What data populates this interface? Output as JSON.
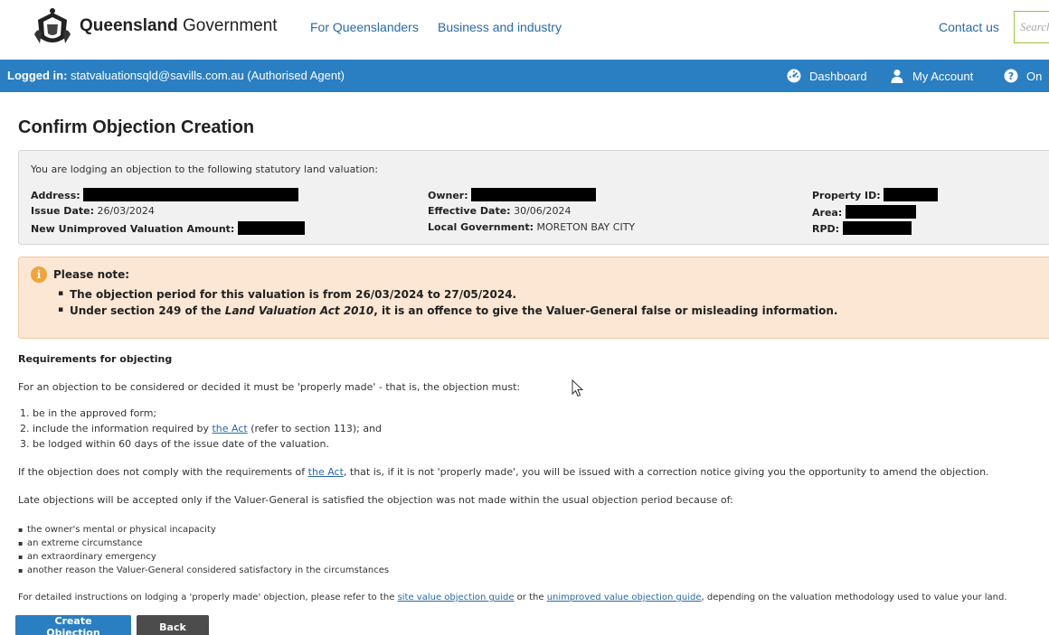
{
  "header": {
    "brand_bold": "Queensland",
    "brand_rest": " Government",
    "nav": [
      "For Queenslanders",
      "Business and industry"
    ],
    "contact": "Contact us",
    "search_placeholder": "Search"
  },
  "userbar": {
    "logged_label": "Logged in:",
    "logged_value": " statvaluationsqld@savills.com.au (Authorised Agent)",
    "dashboard": "Dashboard",
    "my_account": "My Account",
    "online_help": "On"
  },
  "page": {
    "title": "Confirm Objection Creation"
  },
  "summary": {
    "intro": "You are lodging an objection to the following statutory land valuation:",
    "address_label": "Address:",
    "issue_date_label": "Issue Date:",
    "issue_date": "26/03/2024",
    "amount_label": "New Unimproved Valuation Amount:",
    "owner_label": "Owner:",
    "effective_date_label": "Effective Date:",
    "effective_date": "30/06/2024",
    "local_gov_label": "Local Government:",
    "local_gov": "MORETON BAY CITY",
    "property_id_label": "Property ID:",
    "area_label": "Area:",
    "rpd_label": "RPD:"
  },
  "note": {
    "title": "Please note:",
    "item1": "The objection period for this valuation is from 26/03/2024 to 27/05/2024.",
    "item2_pre": "Under section 249 of the ",
    "item2_act": "Land Valuation Act 2010",
    "item2_post": ", it is an offence to give the Valuer-General false or misleading information."
  },
  "requirements": {
    "title": "Requirements for objecting",
    "intro": "For an objection to be considered or decided it must be 'properly made' - that is, the objection must:",
    "list1": "1. be in the approved form;",
    "list2_pre": "2. include the information required by ",
    "list2_link": "the Act",
    "list2_post": " (refer to section 113); and",
    "list3": "3. be lodged within 60 days of the issue date of the valuation.",
    "comply_pre": "If the objection does not comply with the requirements of ",
    "comply_link": "the Act",
    "comply_post": ", that is, if it is not 'properly made', you will be issued with a correction notice giving you the opportunity to amend the objection.",
    "late": "Late objections will be accepted only if the Valuer-General is satisfied the objection was not made within the usual objection period because of:",
    "reasons": [
      "the owner's mental or physical incapacity",
      "an extreme circumstance",
      "an extraordinary emergency",
      "another reason the Valuer-General considered satisfactory in the circumstances"
    ],
    "guide_pre": "For detailed instructions on lodging a 'properly made' objection, please refer to the ",
    "guide_link1": "site value objection guide",
    "guide_mid": " or the ",
    "guide_link2": "unimproved value objection guide",
    "guide_post": ", depending on the valuation methodology used to value your land."
  },
  "actions": {
    "create": "Create Objection",
    "back": "Back"
  },
  "colors": {
    "brand_blue": "#2a7ec2",
    "link": "#2a6aa8",
    "note_bg": "#fbe7d3",
    "back_btn": "#4c4c4c"
  }
}
